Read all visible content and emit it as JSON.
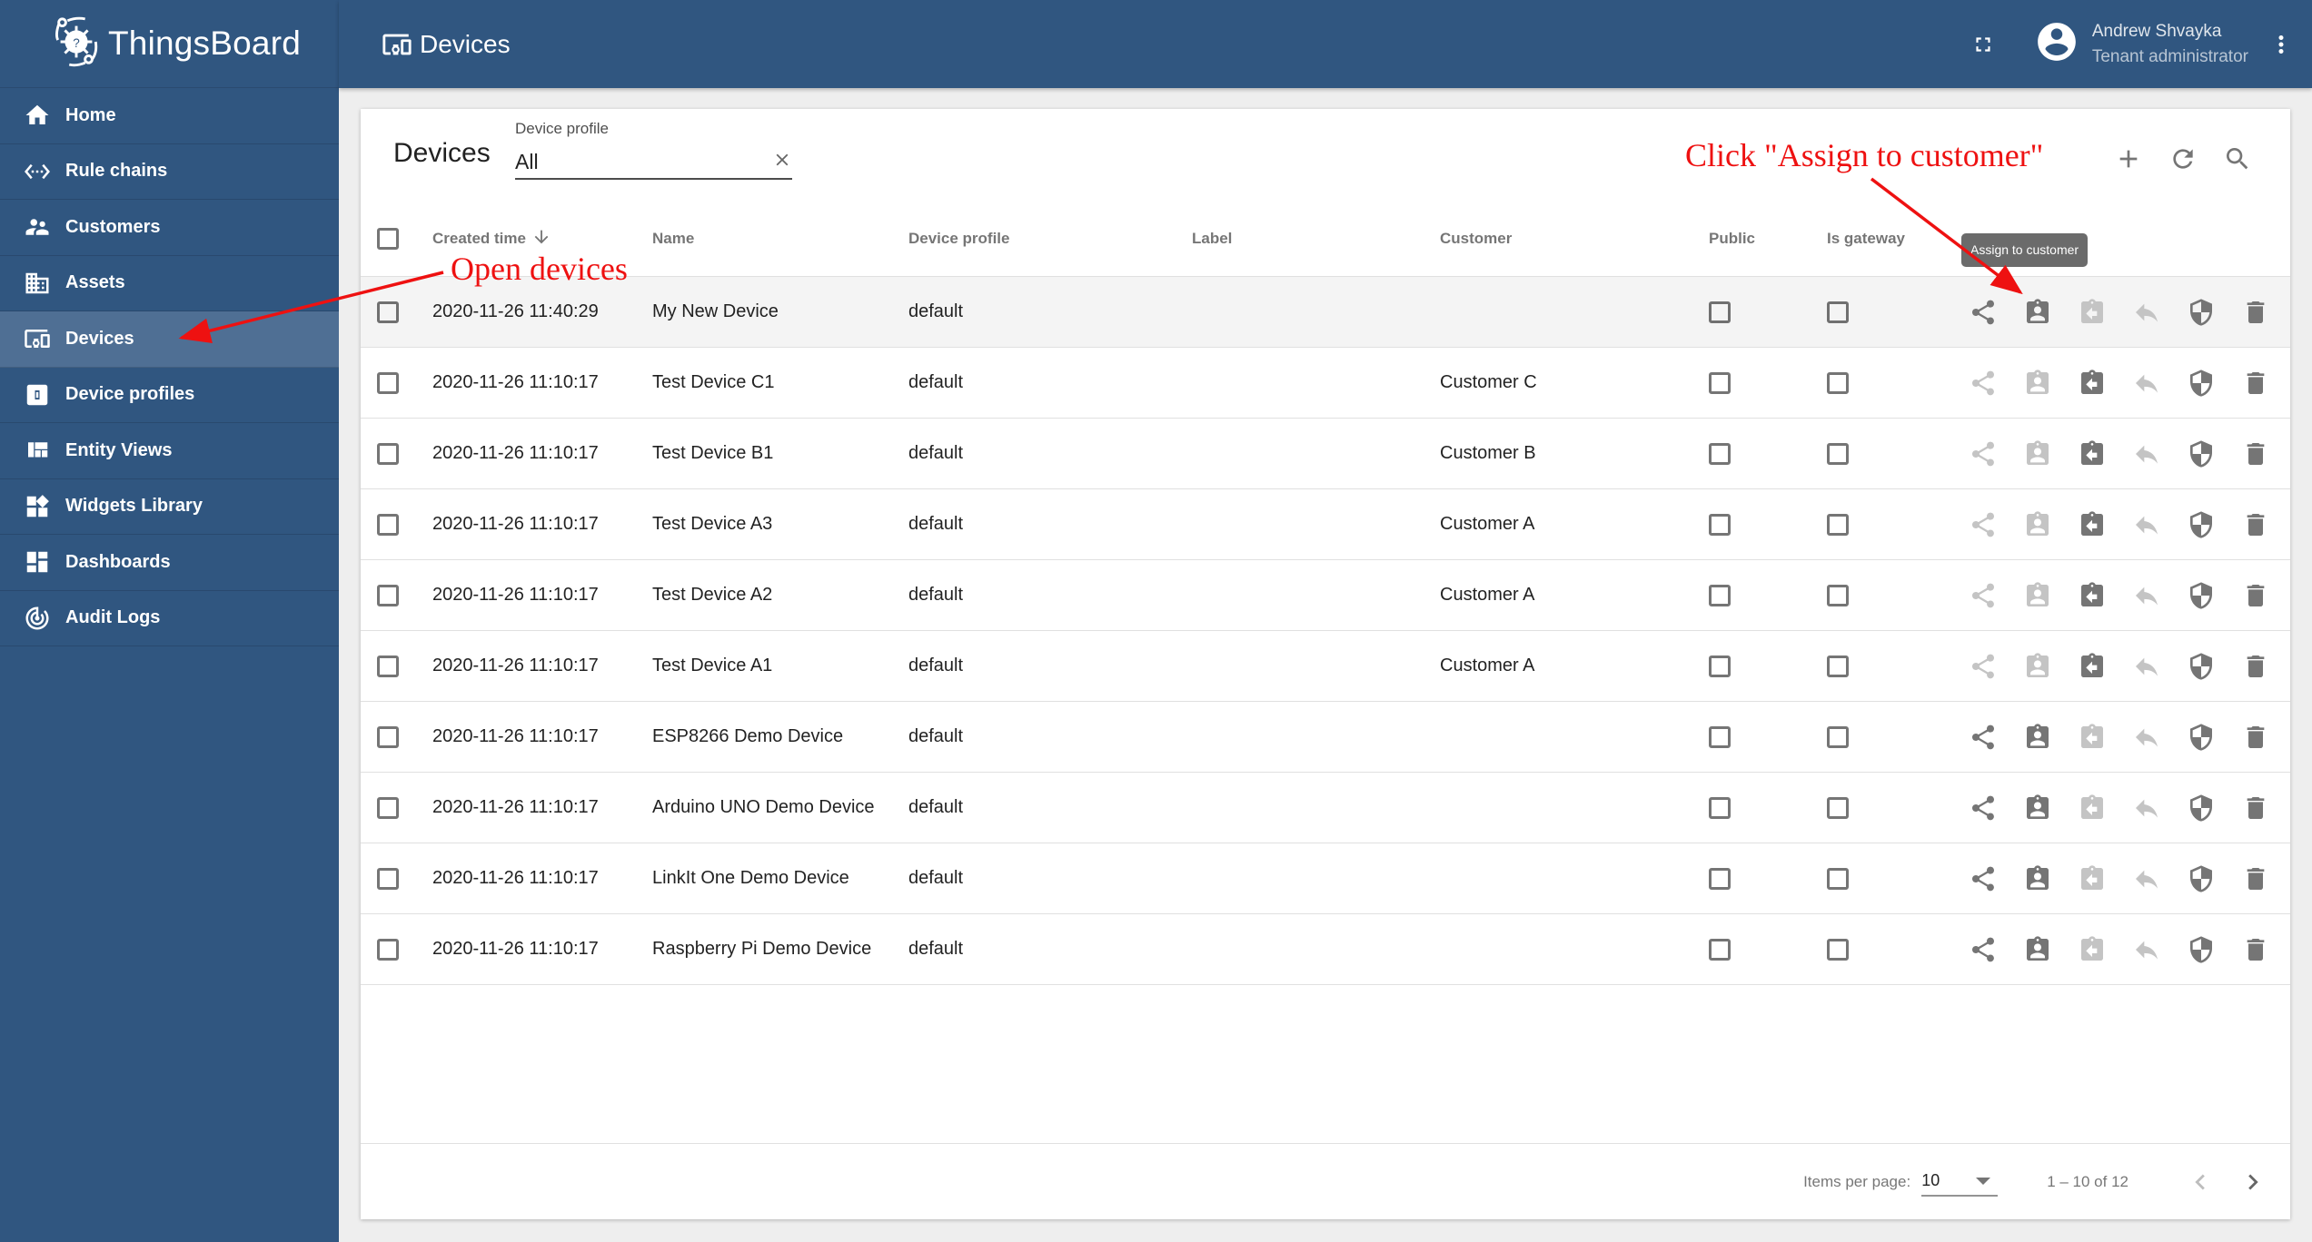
{
  "app": {
    "name": "ThingsBoard"
  },
  "sidebar": {
    "items": [
      {
        "label": "Home",
        "icon": "home-icon"
      },
      {
        "label": "Rule chains",
        "icon": "settings-ethernet-icon"
      },
      {
        "label": "Customers",
        "icon": "supervisor-account-icon"
      },
      {
        "label": "Assets",
        "icon": "domain-icon"
      },
      {
        "label": "Devices",
        "icon": "devices-other-icon",
        "active": true
      },
      {
        "label": "Device profiles",
        "icon": "device-profile-icon"
      },
      {
        "label": "Entity Views",
        "icon": "view-quilt-icon"
      },
      {
        "label": "Widgets Library",
        "icon": "widgets-icon"
      },
      {
        "label": "Dashboards",
        "icon": "dashboard-icon"
      },
      {
        "label": "Audit Logs",
        "icon": "track-changes-icon"
      }
    ]
  },
  "header": {
    "title": "Devices",
    "user": {
      "name": "Andrew Shvayka",
      "role": "Tenant administrator"
    }
  },
  "card": {
    "title": "Devices",
    "filter": {
      "label": "Device profile",
      "value": "All"
    }
  },
  "table": {
    "columns": {
      "created_time": "Created time",
      "name": "Name",
      "device_profile": "Device profile",
      "label": "Label",
      "customer": "Customer",
      "public": "Public",
      "is_gateway": "Is gateway"
    },
    "sort": {
      "column": "created_time",
      "direction": "desc"
    },
    "rows": [
      {
        "created_time": "2020-11-26 11:40:29",
        "name": "My New Device",
        "device_profile": "default",
        "label": "",
        "customer": "",
        "public": false,
        "is_gateway": false,
        "assigned": false
      },
      {
        "created_time": "2020-11-26 11:10:17",
        "name": "Test Device C1",
        "device_profile": "default",
        "label": "",
        "customer": "Customer C",
        "public": false,
        "is_gateway": false,
        "assigned": true
      },
      {
        "created_time": "2020-11-26 11:10:17",
        "name": "Test Device B1",
        "device_profile": "default",
        "label": "",
        "customer": "Customer B",
        "public": false,
        "is_gateway": false,
        "assigned": true
      },
      {
        "created_time": "2020-11-26 11:10:17",
        "name": "Test Device A3",
        "device_profile": "default",
        "label": "",
        "customer": "Customer A",
        "public": false,
        "is_gateway": false,
        "assigned": true
      },
      {
        "created_time": "2020-11-26 11:10:17",
        "name": "Test Device A2",
        "device_profile": "default",
        "label": "",
        "customer": "Customer A",
        "public": false,
        "is_gateway": false,
        "assigned": true
      },
      {
        "created_time": "2020-11-26 11:10:17",
        "name": "Test Device A1",
        "device_profile": "default",
        "label": "",
        "customer": "Customer A",
        "public": false,
        "is_gateway": false,
        "assigned": true
      },
      {
        "created_time": "2020-11-26 11:10:17",
        "name": "ESP8266 Demo Device",
        "device_profile": "default",
        "label": "",
        "customer": "",
        "public": false,
        "is_gateway": false,
        "assigned": false
      },
      {
        "created_time": "2020-11-26 11:10:17",
        "name": "Arduino UNO Demo Device",
        "device_profile": "default",
        "label": "",
        "customer": "",
        "public": false,
        "is_gateway": false,
        "assigned": false
      },
      {
        "created_time": "2020-11-26 11:10:17",
        "name": "LinkIt One Demo Device",
        "device_profile": "default",
        "label": "",
        "customer": "",
        "public": false,
        "is_gateway": false,
        "assigned": false
      },
      {
        "created_time": "2020-11-26 11:10:17",
        "name": "Raspberry Pi Demo Device",
        "device_profile": "default",
        "label": "",
        "customer": "",
        "public": false,
        "is_gateway": false,
        "assigned": false
      }
    ],
    "row_actions": [
      "Make public",
      "Assign to customer",
      "Unassign from customer",
      "Make private",
      "Manage credentials",
      "Delete"
    ]
  },
  "tooltip": "Assign to customer",
  "annotations": {
    "open_devices": "Open devices",
    "assign_customer": "Click \"Assign to customer\""
  },
  "paginator": {
    "items_per_page_label": "Items per page:",
    "items_per_page": "10",
    "range": "1 – 10 of 12"
  },
  "colors": {
    "primary": "#305680",
    "active_nav": "#4f6f94",
    "annotation": "#ee1111"
  }
}
